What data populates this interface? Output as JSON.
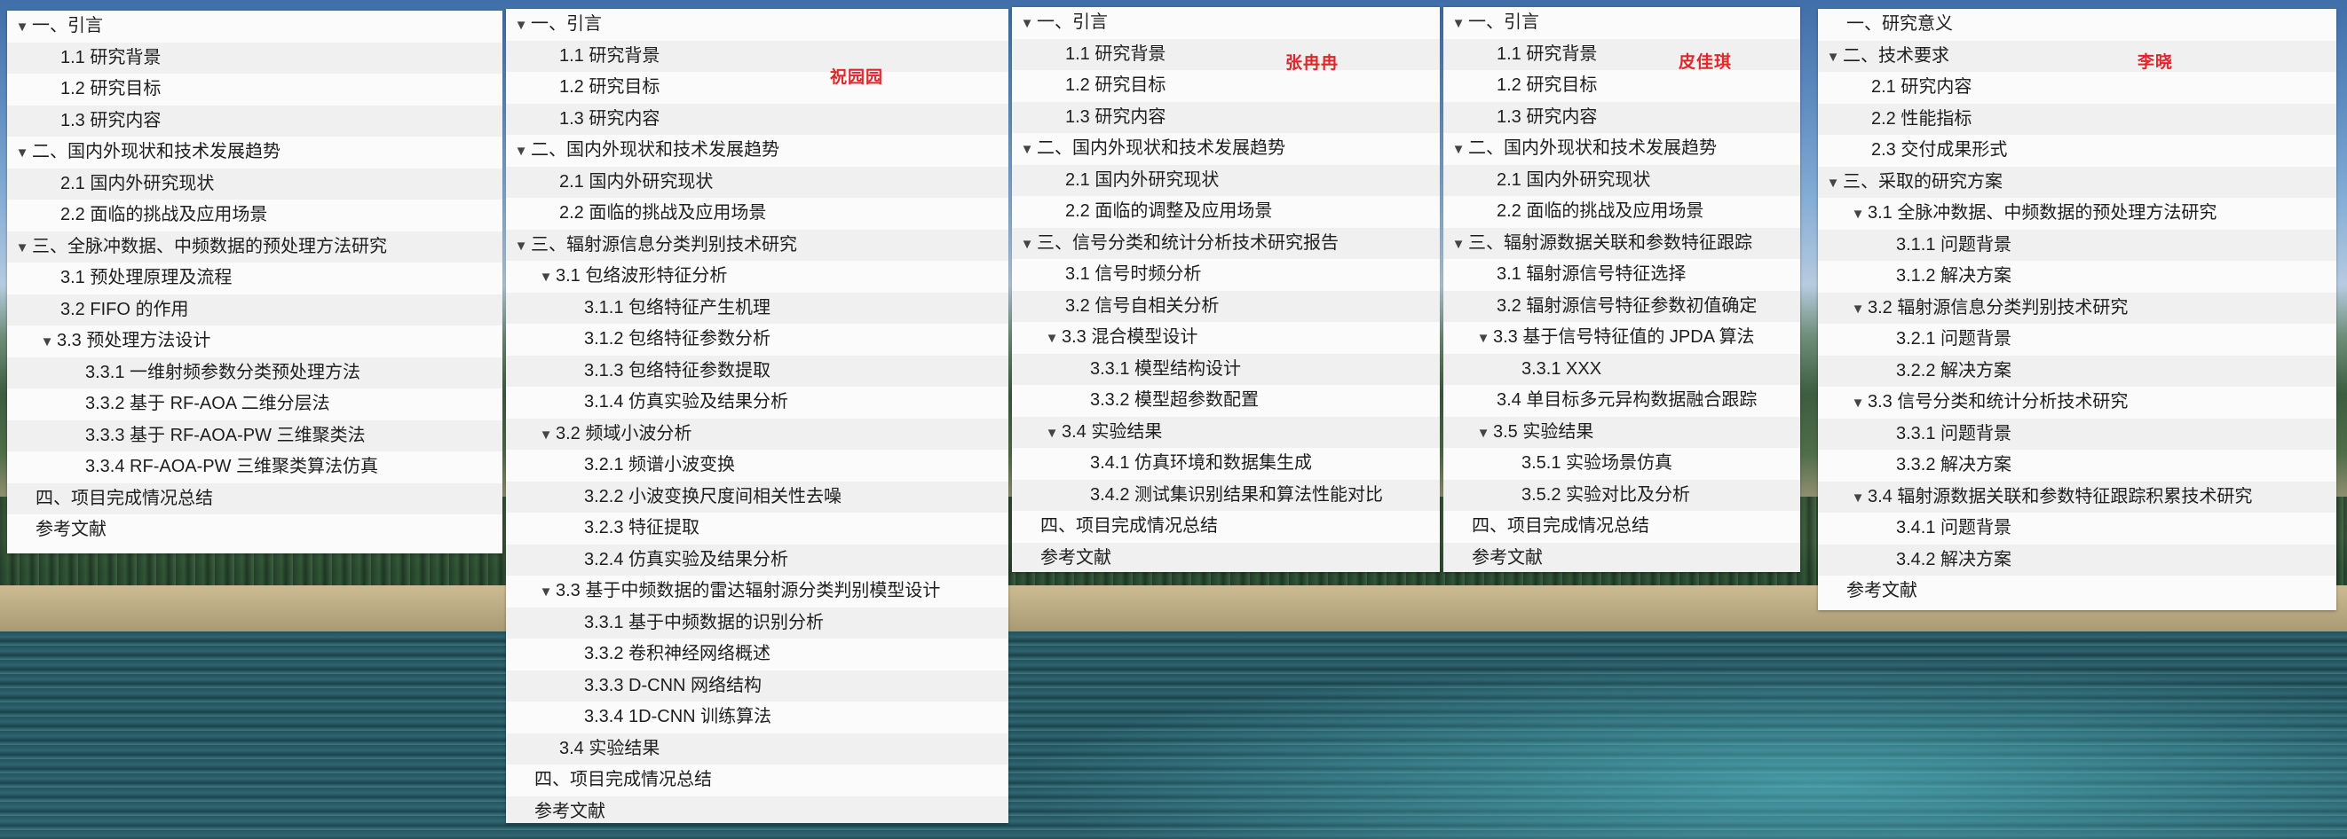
{
  "colors": {
    "signature": "#e0262b",
    "row_alt": "#f0f0f0",
    "panel_bg": "#fbfbfb"
  },
  "icons": {
    "expanded": "disclosure-triangle-down-icon"
  },
  "panels": [
    {
      "signature": "",
      "items": [
        {
          "label": "一、引言",
          "level": 0,
          "expanded": true
        },
        {
          "label": "1.1 研究背景",
          "level": 1
        },
        {
          "label": "1.2 研究目标",
          "level": 1
        },
        {
          "label": "1.3 研究内容",
          "level": 1
        },
        {
          "label": "二、国内外现状和技术发展趋势",
          "level": 0,
          "expanded": true
        },
        {
          "label": "2.1 国内外研究现状",
          "level": 1
        },
        {
          "label": "2.2 面临的挑战及应用场景",
          "level": 1
        },
        {
          "label": "三、全脉冲数据、中频数据的预处理方法研究",
          "level": 0,
          "expanded": true
        },
        {
          "label": "3.1 预处理原理及流程",
          "level": 1
        },
        {
          "label": "3.2 FIFO 的作用",
          "level": 1
        },
        {
          "label": "3.3 预处理方法设计",
          "level": 1,
          "expanded": true
        },
        {
          "label": "3.3.1 一维射频参数分类预处理方法",
          "level": 2
        },
        {
          "label": "3.3.2 基于 RF-AOA 二维分层法",
          "level": 2
        },
        {
          "label": "3.3.3 基于 RF-AOA-PW 三维聚类法",
          "level": 2
        },
        {
          "label": "3.3.4 RF-AOA-PW 三维聚类算法仿真",
          "level": 2
        },
        {
          "label": "四、项目完成情况总结",
          "level": 0
        },
        {
          "label": "参考文献",
          "level": 0
        }
      ]
    },
    {
      "signature": "祝园园",
      "items": [
        {
          "label": "一、引言",
          "level": 0,
          "expanded": true
        },
        {
          "label": "1.1 研究背景",
          "level": 1
        },
        {
          "label": "1.2 研究目标",
          "level": 1
        },
        {
          "label": "1.3 研究内容",
          "level": 1
        },
        {
          "label": "二、国内外现状和技术发展趋势",
          "level": 0,
          "expanded": true
        },
        {
          "label": "2.1 国内外研究现状",
          "level": 1
        },
        {
          "label": "2.2 面临的挑战及应用场景",
          "level": 1
        },
        {
          "label": "三、辐射源信息分类判别技术研究",
          "level": 0,
          "expanded": true
        },
        {
          "label": "3.1 包络波形特征分析",
          "level": 1,
          "expanded": true
        },
        {
          "label": "3.1.1 包络特征产生机理",
          "level": 2
        },
        {
          "label": "3.1.2 包络特征参数分析",
          "level": 2
        },
        {
          "label": "3.1.3 包络特征参数提取",
          "level": 2
        },
        {
          "label": "3.1.4 仿真实验及结果分析",
          "level": 2
        },
        {
          "label": "3.2 频域小波分析",
          "level": 1,
          "expanded": true
        },
        {
          "label": "3.2.1 频谱小波变换",
          "level": 2
        },
        {
          "label": "3.2.2 小波变换尺度间相关性去噪",
          "level": 2
        },
        {
          "label": "3.2.3 特征提取",
          "level": 2
        },
        {
          "label": "3.2.4 仿真实验及结果分析",
          "level": 2
        },
        {
          "label": "3.3 基于中频数据的雷达辐射源分类判别模型设计",
          "level": 1,
          "expanded": true
        },
        {
          "label": "3.3.1 基于中频数据的识别分析",
          "level": 2
        },
        {
          "label": "3.3.2 卷积神经网络概述",
          "level": 2
        },
        {
          "label": "3.3.3 D-CNN 网络结构",
          "level": 2
        },
        {
          "label": "3.3.4 1D-CNN 训练算法",
          "level": 2
        },
        {
          "label": "3.4 实验结果",
          "level": 1
        },
        {
          "label": "四、项目完成情况总结",
          "level": 0
        },
        {
          "label": "参考文献",
          "level": 0
        }
      ]
    },
    {
      "signature": "张冉冉",
      "items": [
        {
          "label": "一、引言",
          "level": 0,
          "expanded": true
        },
        {
          "label": "1.1 研究背景",
          "level": 1
        },
        {
          "label": "1.2 研究目标",
          "level": 1
        },
        {
          "label": "1.3 研究内容",
          "level": 1
        },
        {
          "label": "二、国内外现状和技术发展趋势",
          "level": 0,
          "expanded": true
        },
        {
          "label": "2.1 国内外研究现状",
          "level": 1
        },
        {
          "label": "2.2 面临的调整及应用场景",
          "level": 1
        },
        {
          "label": "三、信号分类和统计分析技术研究报告",
          "level": 0,
          "expanded": true
        },
        {
          "label": "3.1 信号时频分析",
          "level": 1
        },
        {
          "label": "3.2 信号自相关分析",
          "level": 1
        },
        {
          "label": "3.3 混合模型设计",
          "level": 1,
          "expanded": true
        },
        {
          "label": "3.3.1 模型结构设计",
          "level": 2
        },
        {
          "label": "3.3.2 模型超参数配置",
          "level": 2
        },
        {
          "label": "3.4 实验结果",
          "level": 1,
          "expanded": true
        },
        {
          "label": "3.4.1 仿真环境和数据集生成",
          "level": 2
        },
        {
          "label": "3.4.2 测试集识别结果和算法性能对比",
          "level": 2
        },
        {
          "label": "四、项目完成情况总结",
          "level": 0
        },
        {
          "label": "参考文献",
          "level": 0
        }
      ]
    },
    {
      "signature": "皮佳琪",
      "items": [
        {
          "label": "一、引言",
          "level": 0,
          "expanded": true
        },
        {
          "label": "1.1 研究背景",
          "level": 1
        },
        {
          "label": "1.2 研究目标",
          "level": 1
        },
        {
          "label": "1.3 研究内容",
          "level": 1
        },
        {
          "label": "二、国内外现状和技术发展趋势",
          "level": 0,
          "expanded": true
        },
        {
          "label": "2.1 国内外研究现状",
          "level": 1
        },
        {
          "label": "2.2 面临的挑战及应用场景",
          "level": 1
        },
        {
          "label": "三、辐射源数据关联和参数特征跟踪",
          "level": 0,
          "expanded": true
        },
        {
          "label": "3.1 辐射源信号特征选择",
          "level": 1
        },
        {
          "label": "3.2 辐射源信号特征参数初值确定",
          "level": 1
        },
        {
          "label": "3.3 基于信号特征值的 JPDA 算法",
          "level": 1,
          "expanded": true
        },
        {
          "label": "3.3.1 XXX",
          "level": 2
        },
        {
          "label": "3.4 单目标多元异构数据融合跟踪",
          "level": 1
        },
        {
          "label": "3.5 实验结果",
          "level": 1,
          "expanded": true
        },
        {
          "label": "3.5.1 实验场景仿真",
          "level": 2
        },
        {
          "label": "3.5.2 实验对比及分析",
          "level": 2
        },
        {
          "label": "四、项目完成情况总结",
          "level": 0
        },
        {
          "label": "参考文献",
          "level": 0
        }
      ]
    },
    {
      "signature": "李晓",
      "items": [
        {
          "label": "一、研究意义",
          "level": 0
        },
        {
          "label": "二、技术要求",
          "level": 0,
          "expanded": true
        },
        {
          "label": "2.1 研究内容",
          "level": 1
        },
        {
          "label": "2.2 性能指标",
          "level": 1
        },
        {
          "label": "2.3 交付成果形式",
          "level": 1
        },
        {
          "label": "三、采取的研究方案",
          "level": 0,
          "expanded": true
        },
        {
          "label": "3.1 全脉冲数据、中频数据的预处理方法研究",
          "level": 1,
          "expanded": true
        },
        {
          "label": "3.1.1 问题背景",
          "level": 2
        },
        {
          "label": "3.1.2 解决方案",
          "level": 2
        },
        {
          "label": "3.2 辐射源信息分类判别技术研究",
          "level": 1,
          "expanded": true
        },
        {
          "label": "3.2.1 问题背景",
          "level": 2
        },
        {
          "label": "3.2.2 解决方案",
          "level": 2
        },
        {
          "label": "3.3 信号分类和统计分析技术研究",
          "level": 1,
          "expanded": true
        },
        {
          "label": "3.3.1 问题背景",
          "level": 2
        },
        {
          "label": "3.3.2 解决方案",
          "level": 2
        },
        {
          "label": "3.4 辐射源数据关联和参数特征跟踪积累技术研究",
          "level": 1,
          "expanded": true
        },
        {
          "label": "3.4.1 问题背景",
          "level": 2
        },
        {
          "label": "3.4.2 解决方案",
          "level": 2
        },
        {
          "label": "参考文献",
          "level": 0
        }
      ]
    }
  ]
}
